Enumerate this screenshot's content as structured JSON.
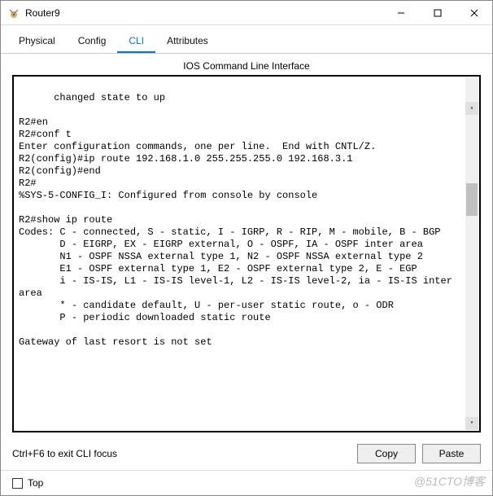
{
  "window": {
    "title": "Router9"
  },
  "tabs": {
    "physical": "Physical",
    "config": "Config",
    "cli": "CLI",
    "attributes": "Attributes"
  },
  "section": {
    "title": "IOS Command Line Interface"
  },
  "cli": {
    "text": "changed state to up\n\nR2#en\nR2#conf t\nEnter configuration commands, one per line.  End with CNTL/Z.\nR2(config)#ip route 192.168.1.0 255.255.255.0 192.168.3.1\nR2(config)#end\nR2#\n%SYS-5-CONFIG_I: Configured from console by console\n\nR2#show ip route\nCodes: C - connected, S - static, I - IGRP, R - RIP, M - mobile, B - BGP\n       D - EIGRP, EX - EIGRP external, O - OSPF, IA - OSPF inter area\n       N1 - OSPF NSSA external type 1, N2 - OSPF NSSA external type 2\n       E1 - OSPF external type 1, E2 - OSPF external type 2, E - EGP\n       i - IS-IS, L1 - IS-IS level-1, L2 - IS-IS level-2, ia - IS-IS inter area\n       * - candidate default, U - per-user static route, o - ODR\n       P - periodic downloaded static route\n\nGateway of last resort is not set"
  },
  "buttons": {
    "copy": "Copy",
    "paste": "Paste"
  },
  "hint": "Ctrl+F6 to exit CLI focus",
  "footer": {
    "top": "Top"
  },
  "watermark": "@51CTO博客"
}
